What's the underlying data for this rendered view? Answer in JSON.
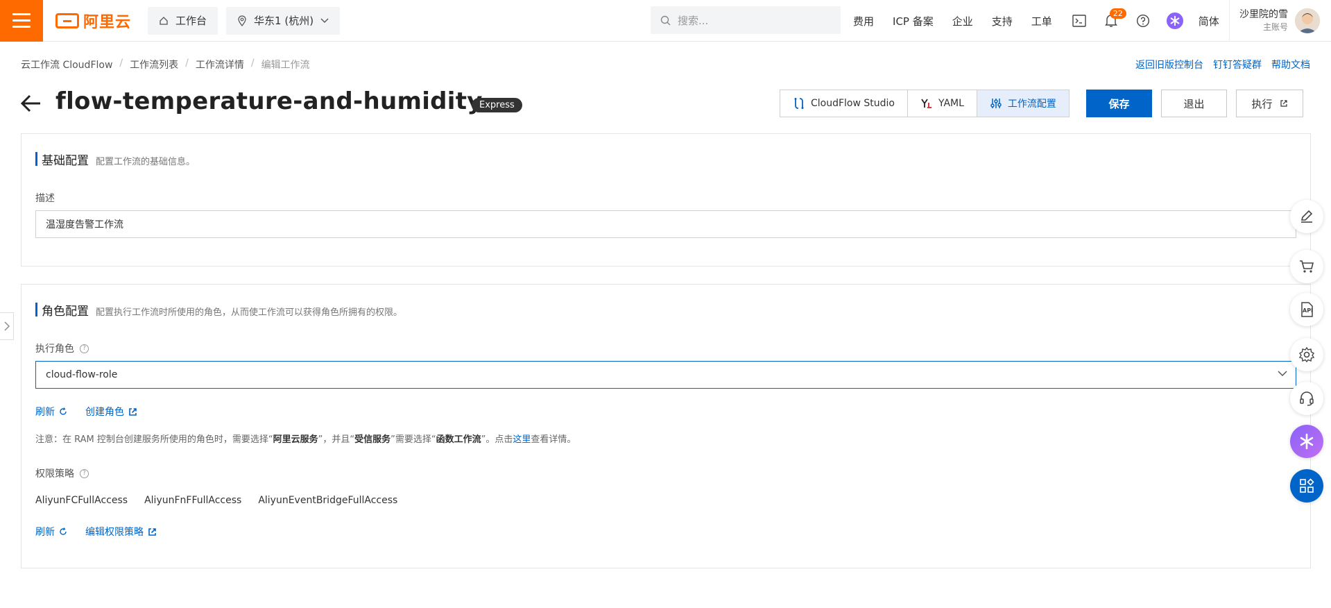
{
  "topbar": {
    "logo_text": "阿里云",
    "workbench": "工作台",
    "region": "华东1 (杭州)",
    "search_placeholder": "搜索...",
    "links": [
      "费用",
      "ICP 备案",
      "企业",
      "支持",
      "工单"
    ],
    "notification_count": "22",
    "language": "简体",
    "user_name": "沙里院的雪",
    "user_role": "主账号"
  },
  "breadcrumb": {
    "items": [
      "云工作流 CloudFlow",
      "工作流列表",
      "工作流详情"
    ],
    "current": "编辑工作流"
  },
  "help_links": [
    "返回旧版控制台",
    "钉钉答疑群",
    "帮助文档"
  ],
  "header": {
    "title": "flow-temperature-and-humidity-...",
    "badge": "Express",
    "tabs": [
      "CloudFlow Studio",
      "YAML",
      "工作流配置"
    ],
    "save": "保存",
    "exit": "退出",
    "execute": "执行"
  },
  "basic": {
    "title": "基础配置",
    "desc": "配置工作流的基础信息。",
    "field_label": "描述",
    "field_value": "温湿度告警工作流"
  },
  "role": {
    "title": "角色配置",
    "desc": "配置执行工作流时所使用的角色，从而使工作流可以获得角色所拥有的权限。",
    "field_label": "执行角色",
    "selected": "cloud-flow-role",
    "refresh": "刷新",
    "create_role": "创建角色",
    "note_prefix": "注意：在 RAM 控制台创建服务所使用的角色时，需要选择“",
    "note_b1": "阿里云服务",
    "note_mid1": "”，并且“",
    "note_b2": "受信服务",
    "note_mid2": "”需要选择“",
    "note_b3": "函数工作流",
    "note_mid3": "”。点击",
    "note_link": "这里",
    "note_suffix": "查看详情。",
    "policy_label": "权限策略",
    "policies": [
      "AliyunFCFullAccess",
      "AliyunFnFFullAccess",
      "AliyunEventBridgeFullAccess"
    ],
    "refresh2": "刷新",
    "edit_policy": "编辑权限策略"
  },
  "colors": {
    "brand": "#ff6a00",
    "primary": "#0064c8"
  }
}
